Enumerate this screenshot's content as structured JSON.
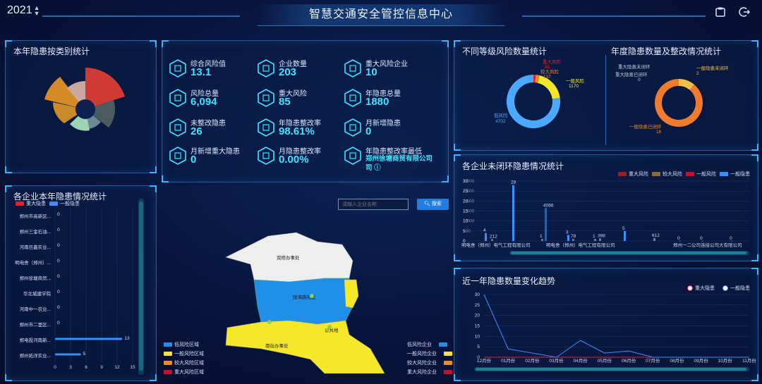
{
  "header": {
    "year": "2021",
    "title": "智慧交通安全管控信息中心"
  },
  "panels": {
    "category": "本年隐患按类别统计",
    "stats": "",
    "companies_hidden": "各企业本年隐患情况统计",
    "risk_levels": "不同等级风险数量统计",
    "annual": "年度隐患数量及整改情况统计",
    "unclosed": "各企业未闭环隐患情况统计",
    "trend": "近一年隐患数量变化趋势"
  },
  "stats": [
    {
      "label": "综合风险值",
      "value": "13.1"
    },
    {
      "label": "企业数量",
      "value": "203"
    },
    {
      "label": "重大风险企业",
      "value": "10"
    },
    {
      "label": "风险总量",
      "value": "6,094"
    },
    {
      "label": "重大风险",
      "value": "85"
    },
    {
      "label": "年隐患总量",
      "value": "1880"
    },
    {
      "label": "未整改隐患",
      "value": "26"
    },
    {
      "label": "年隐患整改率",
      "value": "98.61%"
    },
    {
      "label": "月新增隐患",
      "value": "0"
    },
    {
      "label": "月新增重大隐患",
      "value": "0"
    },
    {
      "label": "月隐患整改率",
      "value": "0.00%"
    },
    {
      "label": "年隐患整改率最低",
      "value": "郑州徐塘商贸有限公司",
      "suffix": "司 ⓘ"
    }
  ],
  "colors": {
    "accent": "#3fe3ff",
    "major": "#e0222a",
    "general": "#3a8fff",
    "low": "#4aa8ff",
    "mid": "#f2e82a",
    "high": "#f08a24"
  },
  "company_bars": {
    "legend": [
      "重大隐患",
      "一般隐患"
    ],
    "rows": [
      {
        "name": "郑州市高新区...",
        "value": 0
      },
      {
        "name": "郑州三金石油...",
        "value": 0
      },
      {
        "name": "河南巨鑫实业...",
        "value": 0
      },
      {
        "name": "明电舍（郑州）...",
        "value": 0
      },
      {
        "name": "郑州徐塘商贸...",
        "value": 0
      },
      {
        "name": "华北城建学院",
        "value": 0
      },
      {
        "name": "河南中一农业...",
        "value": 0
      },
      {
        "name": "郑州市二里区...",
        "value": 0
      },
      {
        "name": "郑电投河南新...",
        "value": 13
      },
      {
        "name": "郑州拓洋实业...",
        "value": 5
      }
    ],
    "xticks": [
      "0",
      "3",
      "6",
      "9",
      "12",
      "15"
    ]
  },
  "search": {
    "placeholder": "请输入企业名称",
    "button": "搜索"
  },
  "map": {
    "regions": [
      "双桥办事处",
      "陇海路街区",
      "公共地",
      "南街办事处"
    ],
    "legend_left": [
      "低风险区域",
      "一般风险区域",
      "较大风险区域",
      "重大风险区域"
    ],
    "legend_right": [
      "低风险企业",
      "一般风险企业",
      "较大风险企业",
      "重大风险企业"
    ]
  },
  "risk_donut": {
    "labels": [
      {
        "name": "重大风险",
        "value": "85"
      },
      {
        "name": "较大风险",
        "value": "137"
      },
      {
        "name": "一般风险",
        "value": "1170"
      },
      {
        "name": "低风险",
        "value": "4702"
      }
    ]
  },
  "annual_donut": {
    "labels": [
      {
        "name": "重大隐患未闭环",
        "value": ""
      },
      {
        "name": "重大隐患已闭环",
        "value": "0"
      },
      {
        "name": "一般隐患未闭环",
        "value": "2"
      },
      {
        "name": "一般隐患已闭环",
        "value": "16"
      }
    ]
  },
  "unclosed": {
    "legend": [
      "重大风险",
      "较大风险",
      "一般风险",
      "一般隐患"
    ],
    "yleft": [
      "30",
      "25",
      "20",
      "15",
      "10",
      "5",
      "0"
    ],
    "yright": [
      "3,000",
      "2,500",
      "2,000",
      "1,500",
      "1,000",
      "500",
      "0"
    ],
    "companies": [
      "明电舍（郑州）电气工程有限公司",
      "明电舍（郑州）电气工程有限公司",
      "郑州一二公司连接公司大有限公司"
    ],
    "labels": [
      "4",
      "212",
      "28",
      "4066",
      "1",
      "3",
      "78",
      "1",
      "398",
      "5",
      "612",
      "0",
      "0",
      "0"
    ]
  },
  "trend": {
    "legend": [
      "重大隐患",
      "一般隐患"
    ],
    "yticks": [
      "30",
      "25",
      "20",
      "15",
      "10",
      "5",
      "0"
    ],
    "months": [
      "12月份",
      "01月份",
      "02月份",
      "03月份",
      "04月份",
      "05月份",
      "06月份",
      "07月份",
      "08月份",
      "09月份",
      "10月份",
      "11月份"
    ]
  },
  "chart_data": [
    {
      "type": "line",
      "title": "近一年隐患数量变化趋势",
      "categories": [
        "12月份",
        "01月份",
        "02月份",
        "03月份",
        "04月份",
        "05月份",
        "06月份",
        "07月份",
        "08月份",
        "09月份",
        "10月份",
        "11月份"
      ],
      "series": [
        {
          "name": "重大隐患",
          "values": [
            0,
            0,
            0,
            0,
            0,
            0,
            0,
            0,
            0,
            0,
            0,
            0
          ]
        },
        {
          "name": "一般隐患",
          "values": [
            30,
            4,
            2,
            0,
            8,
            2,
            3,
            0,
            0,
            0,
            0,
            0
          ]
        }
      ],
      "ylim": [
        0,
        30
      ]
    },
    {
      "type": "bar",
      "title": "各企业本年隐患情况统计",
      "categories": [
        "郑州市高新区...",
        "郑州三金石油...",
        "河南巨鑫实业...",
        "明电舍（郑州）...",
        "郑州徐塘商贸...",
        "华北城建学院",
        "河南中一农业...",
        "郑州市二里区...",
        "郑电投河南新...",
        "郑州拓洋实业..."
      ],
      "values": [
        0,
        0,
        0,
        0,
        0,
        0,
        0,
        0,
        13,
        5
      ],
      "xlim": [
        0,
        15
      ]
    },
    {
      "type": "pie",
      "title": "不同等级风险数量统计",
      "categories": [
        "重大风险",
        "较大风险",
        "一般风险",
        "低风险"
      ],
      "values": [
        85,
        137,
        1170,
        4702
      ]
    },
    {
      "type": "pie",
      "title": "年度隐患数量及整改情况统计",
      "categories": [
        "重大隐患未闭环",
        "重大隐患已闭环",
        "一般隐患未闭环",
        "一般隐患已闭环"
      ],
      "values": [
        0,
        0,
        2,
        16
      ]
    }
  ]
}
